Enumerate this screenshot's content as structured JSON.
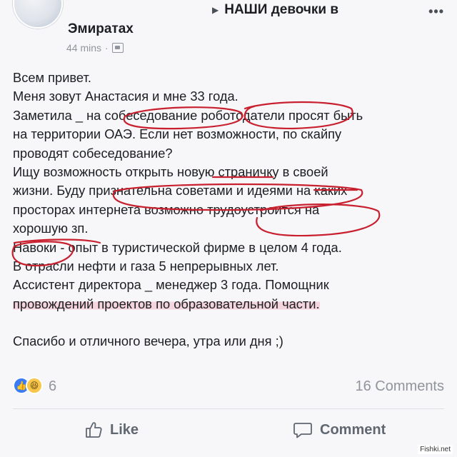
{
  "header": {
    "group_line1": "НАШИ девочки в",
    "group_line2": "Эмиратах",
    "time": "44 mins",
    "separator": "·",
    "more_label": "•••"
  },
  "post": {
    "lines": [
      "Всем привет.",
      "Меня зовут Анастасия и мне 33 года.",
      "Заметила _ на собеседование роботодатели просят быть",
      "на территории ОАЭ. Если нет возможности, по скайпу",
      "проводят собеседование?",
      "Ищу возможность открыть новую страничку в своей",
      "жизни. Буду признательна советами и идеями на каких",
      "просторах интернета возможно трудоустроится на",
      "хорошую зп.",
      "Навоки - опыт в туристической фирме в целом 4 года.",
      "В отрасли нефти  и газа 5 непрерывных лет.",
      "Ассистент директора _ менеджер 3 года. Помощник",
      "провождений проектов по образовательной части.",
      "",
      "Спасибо и отличного вечера, утра или дня ;)"
    ]
  },
  "reactions": {
    "count": "6",
    "comments": "16 Comments"
  },
  "actions": {
    "like": "Like",
    "comment": "Comment"
  },
  "watermark": "Fishki.net",
  "colors": {
    "annotation_red": "#c8202f",
    "highlight_pink": "#ee96aa",
    "like_blue": "#3b7cf5"
  }
}
